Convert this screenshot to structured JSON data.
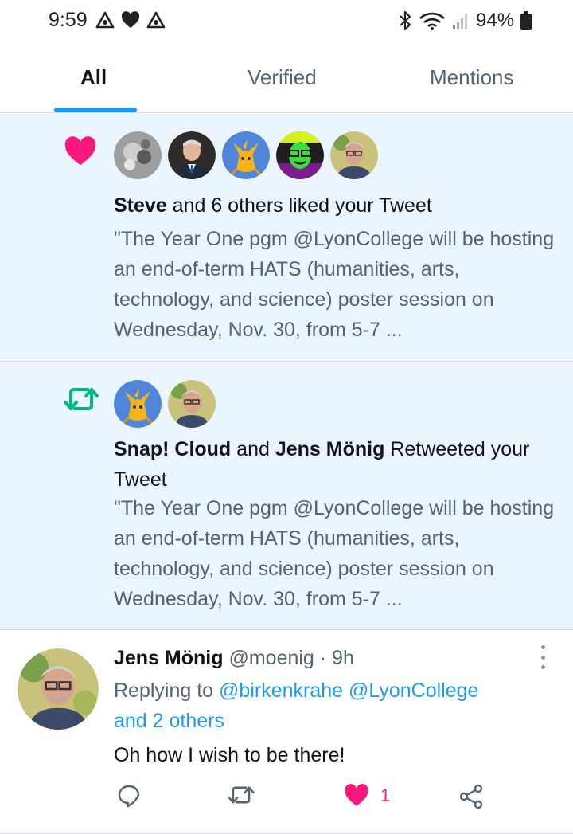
{
  "status_bar": {
    "time": "9:59",
    "battery": "94%",
    "icons": [
      "app-notification-icon",
      "heart-icon",
      "app-notification-icon",
      "bluetooth-icon",
      "wifi-icon",
      "signal-icon",
      "battery-icon"
    ]
  },
  "tabs": [
    {
      "label": "All",
      "active": true
    },
    {
      "label": "Verified",
      "active": false
    },
    {
      "label": "Mentions",
      "active": false
    }
  ],
  "colors": {
    "accent": "#1d9bf0",
    "like": "#f91880",
    "retweet": "#00ba7c",
    "highlight_bg": "#eaf5fd"
  },
  "like_notification": {
    "icon": "heart-icon",
    "actor": "Steve",
    "action_text": " and 6 others liked your Tweet",
    "snippet": "\"The Year One pgm @LyonCollege will be hosting an end-of-term HATS (humanities, arts, technology, and science) poster session on Wednesday, Nov. 30, from 5-7 ...",
    "avatar_count": 5
  },
  "retweet_notification": {
    "icon": "retweet-icon",
    "actor_1": "Snap! Cloud",
    "joiner": " and ",
    "actor_2": "Jens Mönig",
    "action_text": " Retweeted your Tweet",
    "snippet": "\"The Year One pgm @LyonCollege will be hosting an end-of-term HATS (humanities, arts, technology, and science) poster session on Wednesday, Nov. 30, from 5-7 ...",
    "avatar_count": 2
  },
  "reply": {
    "name": "Jens Mönig",
    "meta": " @moenig · 9h",
    "replying_prefix": "Replying to ",
    "mention_1": "@birkenkrahe",
    "mention_2": "@LyonCollege",
    "others": "and 2 others",
    "text": "Oh how I wish to be there!",
    "like_count": "1"
  }
}
